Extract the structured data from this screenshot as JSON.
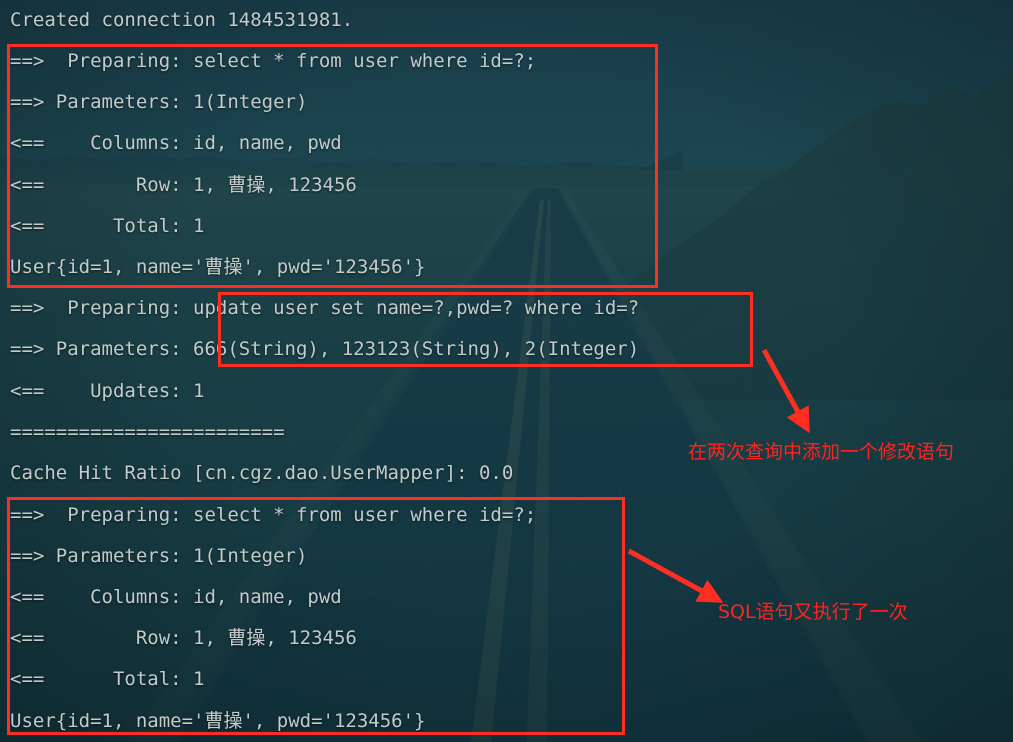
{
  "window": {
    "title": "Console Output",
    "background_image": "desert-highway-wallpaper"
  },
  "colors": {
    "text": "#c3cbcb",
    "annotation": "#ff2420",
    "box_border": "#ff2e22",
    "terminal_tint": "#123944"
  },
  "console": {
    "lines": [
      {
        "text": "Created connection 1484531981."
      },
      {
        "text": "==>  Preparing: select * from user where id=?;"
      },
      {
        "text": "==> Parameters: 1(Integer)"
      },
      {
        "text": "<==    Columns: id, name, pwd"
      },
      {
        "text": "<==        Row: 1, 曹操, 123456"
      },
      {
        "text": "<==      Total: 1"
      },
      {
        "text": "User{id=1, name='曹操', pwd='123456'}"
      },
      {
        "text": "==>  Preparing: update user set name=?,pwd=? where id=?"
      },
      {
        "text": "==> Parameters: 666(String), 123123(String), 2(Integer)"
      },
      {
        "text": "<==    Updates: 1"
      },
      {
        "text": "========================"
      },
      {
        "text": "Cache Hit Ratio [cn.cgz.dao.UserMapper]: 0.0"
      },
      {
        "text": "==>  Preparing: select * from user where id=?;"
      },
      {
        "text": "==> Parameters: 1(Integer)"
      },
      {
        "text": "<==    Columns: id, name, pwd"
      },
      {
        "text": "<==        Row: 1, 曹操, 123456"
      },
      {
        "text": "<==      Total: 1"
      },
      {
        "text": "User{id=1, name='曹操', pwd='123456'}"
      }
    ]
  },
  "annotations": {
    "boxes": [
      {
        "name": "first-query-block-highlight"
      },
      {
        "name": "update-statement-highlight"
      },
      {
        "name": "second-query-block-highlight"
      }
    ],
    "notes": [
      {
        "text": "在两次查询中添加一个修改语句"
      },
      {
        "text": "SQL语句又执行了一次"
      }
    ],
    "arrows": [
      {
        "name": "arrow-to-update-note"
      },
      {
        "name": "arrow-to-second-query-note"
      }
    ]
  }
}
